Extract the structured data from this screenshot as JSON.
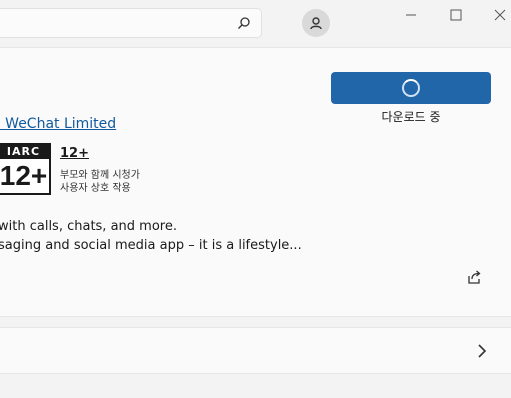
{
  "header": {
    "search_placeholder": "",
    "avatar_icon": "person-icon",
    "window_controls": [
      "minimize-icon",
      "maximize-icon",
      "close-icon"
    ]
  },
  "app": {
    "publisher": "ː WeChat Limited",
    "download_status": "다운로드 중",
    "rating": {
      "badge_top": "IARC",
      "badge_age": "12+",
      "age_label": "12+",
      "line1": "부모와 함께 시청가",
      "line2": "사용자 상호 작용"
    },
    "description": {
      "line1": "with calls, chats, and more.",
      "line2": "saging and social media app – it is a lifestyle..."
    }
  },
  "colors": {
    "accent": "#2166a8",
    "link": "#0f5a9e",
    "background": "#f3f3f3"
  }
}
